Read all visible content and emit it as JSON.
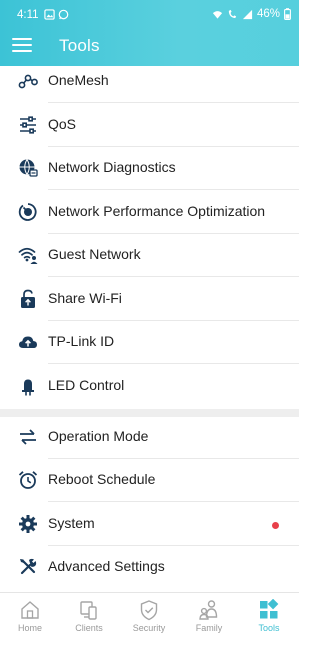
{
  "status_bar": {
    "time": "4:11",
    "battery": "46%"
  },
  "header": {
    "title": "Tools"
  },
  "menu_items": [
    {
      "label": "OneMesh",
      "icon": "onemesh-icon"
    },
    {
      "label": "QoS",
      "icon": "sliders-icon"
    },
    {
      "label": "Network Diagnostics",
      "icon": "globe-diagnostics-icon"
    },
    {
      "label": "Network Performance Optimization",
      "icon": "performance-gauge-icon"
    },
    {
      "label": "Guest Network",
      "icon": "wifi-guest-icon"
    },
    {
      "label": "Share Wi-Fi",
      "icon": "share-lock-icon"
    },
    {
      "label": "TP-Link ID",
      "icon": "cloud-upload-icon"
    },
    {
      "label": "LED Control",
      "icon": "led-icon"
    },
    {
      "label": "Operation Mode",
      "icon": "swap-arrows-icon"
    },
    {
      "label": "Reboot Schedule",
      "icon": "alarm-clock-icon"
    },
    {
      "label": "System",
      "icon": "gear-icon"
    },
    {
      "label": "Advanced Settings",
      "icon": "tools-icon"
    }
  ],
  "tabs": [
    {
      "label": "Home",
      "icon": "home-icon"
    },
    {
      "label": "Clients",
      "icon": "clients-icon"
    },
    {
      "label": "Security",
      "icon": "shield-icon"
    },
    {
      "label": "Family",
      "icon": "family-icon"
    },
    {
      "label": "Tools",
      "icon": "tools-grid-icon",
      "active": true
    }
  ],
  "colors": {
    "header": "#4ccbdb",
    "accent": "#3fbfd2",
    "icon": "#1a3a5a",
    "badge": "#e8404a",
    "tab_inactive": "#9a9a9a"
  }
}
